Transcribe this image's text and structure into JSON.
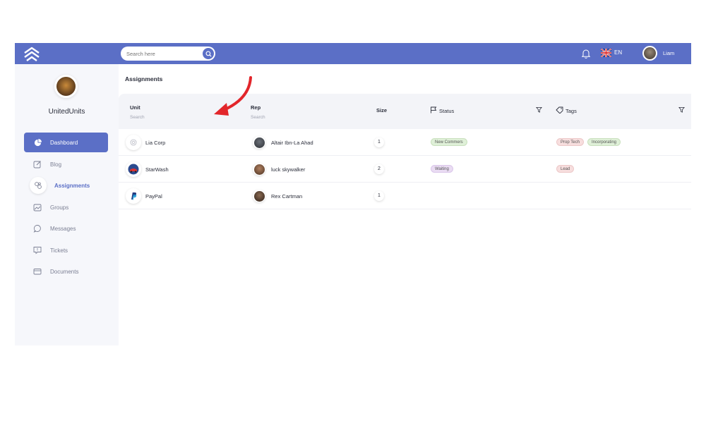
{
  "header": {
    "search_placeholder": "Search here",
    "language": "EN",
    "user_name": "Liam",
    "accent_color": "#5b6fc6"
  },
  "sidebar": {
    "org_name": "UnitedUnits",
    "items": [
      {
        "label": "Dashboard",
        "icon": "pie-chart-icon",
        "state": "active"
      },
      {
        "label": "Blog",
        "icon": "edit-icon",
        "state": "normal"
      },
      {
        "label": "Assignments",
        "icon": "link-icon",
        "state": "selected"
      },
      {
        "label": "Groups",
        "icon": "image-icon",
        "state": "normal"
      },
      {
        "label": "Messages",
        "icon": "chat-icon",
        "state": "normal"
      },
      {
        "label": "Tickets",
        "icon": "alert-message-icon",
        "state": "normal"
      },
      {
        "label": "Documents",
        "icon": "card-icon",
        "state": "normal"
      }
    ]
  },
  "main": {
    "title": "Assignments",
    "columns": {
      "unit": "Unit",
      "unit_search": "Search",
      "rep": "Rep",
      "rep_search": "Search",
      "size": "Size",
      "status": "Status",
      "tags": "Tags"
    },
    "rows": [
      {
        "unit": "Lia Corp",
        "unit_icon": "lia-corp-logo",
        "rep": "Altair Ibn-La Ahad",
        "size": "1",
        "status": [
          "New Commers"
        ],
        "tags": [
          "Prop Tech",
          "Incorporating"
        ]
      },
      {
        "unit": "StarWash",
        "unit_icon": "starwash-logo",
        "rep": "luck skywalker",
        "size": "2",
        "status": [
          "Waiting"
        ],
        "tags": [
          "Lead"
        ]
      },
      {
        "unit": "PayPal",
        "unit_icon": "paypal-logo",
        "rep": "Rex Cartman",
        "size": "1",
        "status": [],
        "tags": []
      }
    ]
  }
}
